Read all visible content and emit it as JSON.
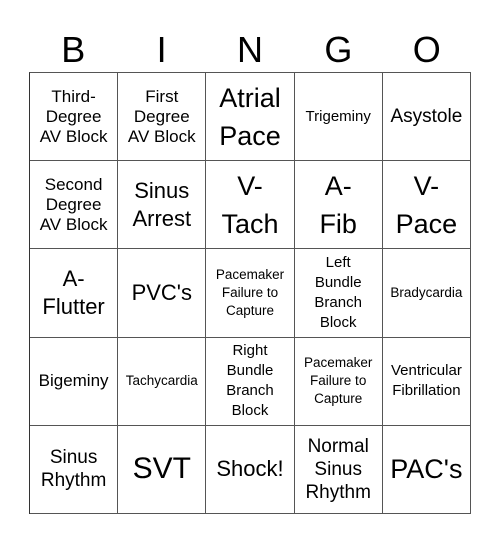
{
  "header": {
    "letters": [
      "B",
      "I",
      "N",
      "G",
      "O"
    ]
  },
  "board": {
    "rows": [
      [
        "Third-\nDegree\nAV Block",
        "First\nDegree\nAV Block",
        "Atrial\nPace",
        "Trigeminy",
        "Asystole"
      ],
      [
        "Second\nDegree\nAV Block",
        "Sinus\nArrest",
        "V-\nTach",
        "A-\nFib",
        "V-\nPace"
      ],
      [
        "A-\nFlutter",
        "PVC's",
        "Pacemaker\nFailure to\nCapture",
        "Left\nBundle\nBranch\nBlock",
        "Bradycardia"
      ],
      [
        "Bigeminy",
        "Tachycardia",
        "Right\nBundle\nBranch\nBlock",
        "Pacemaker\nFailure to\nCapture",
        "Ventricular\nFibrillation"
      ],
      [
        "Sinus\nRhythm",
        "SVT",
        "Shock!",
        "Normal\nSinus\nRhythm",
        "PAC's"
      ]
    ]
  },
  "colors": {
    "grid_line": "#555555",
    "text": "#000000",
    "background": "#ffffff"
  }
}
